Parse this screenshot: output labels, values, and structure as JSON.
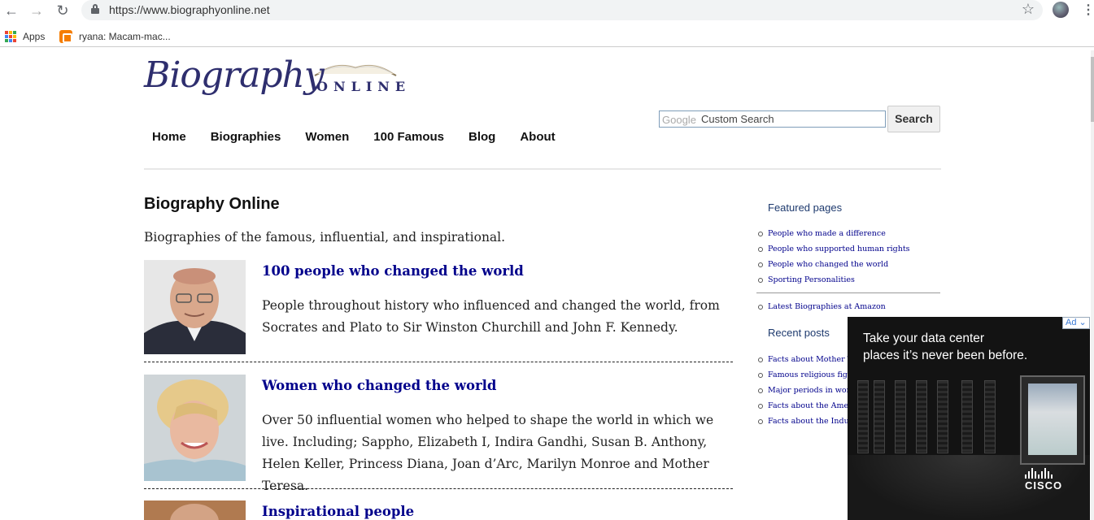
{
  "browser": {
    "url": "https://www.biographyonline.net",
    "bookmarks": [
      {
        "label": "Apps"
      },
      {
        "label": "ryana: Macam-mac..."
      }
    ]
  },
  "site": {
    "logo_script": "Biography",
    "logo_sub": "ONLINE",
    "nav": [
      "Home",
      "Biographies",
      "Women",
      "100 Famous",
      "Blog",
      "About"
    ],
    "search": {
      "google_label": "Google",
      "placeholder": "Custom Search",
      "button": "Search"
    }
  },
  "main": {
    "title": "Biography Online",
    "tagline": "Biographies of the famous, influential, and inspirational.",
    "entries": [
      {
        "title": "100 people who changed the world",
        "desc": "People throughout history who influenced and changed the world, from Socrates and Plato to Sir Winston Churchill and John F. Kennedy."
      },
      {
        "title": "Women who changed the world",
        "desc": "Over 50 influential women who helped to shape the world in which we live. Including; Sappho, Elizabeth I, Indira Gandhi, Susan B. Anthony, Helen Keller, Princess Diana, Joan d’Arc, Marilyn Monroe and Mother Teresa."
      },
      {
        "title": "Inspirational people",
        "desc": ""
      }
    ]
  },
  "sidebar": {
    "featured_title": "Featured pages",
    "featured": [
      "People who made a difference",
      "People who supported human rights",
      "People who changed the world",
      "Sporting Personalities"
    ],
    "amazon": "Latest Biographies at Amazon",
    "recent_title": "Recent posts",
    "recent": [
      "Facts about Mother Te",
      "Famous religious figur",
      "Major periods in world",
      "Facts about the Americ",
      "Facts about the Industr"
    ]
  },
  "ad": {
    "headline_1": "Take your data center",
    "headline_2": "places it’s never been before.",
    "badge": "Ad",
    "brand": "CISCO"
  }
}
